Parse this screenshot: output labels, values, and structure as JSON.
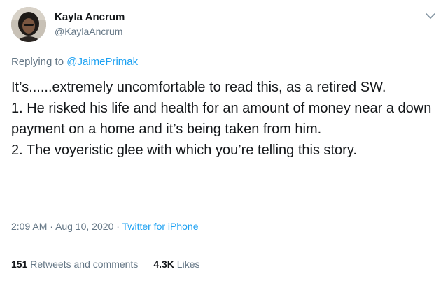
{
  "author": {
    "name": "Kayla Ancrum",
    "handle": "@KaylaAncrum"
  },
  "reply": {
    "prefix": "Replying to",
    "to": "@JaimePrimak"
  },
  "tweet_lines": [
    "It’s......extremely uncomfortable to read this, as a retired SW.",
    "1. He risked his life and health for an amount of money near a down payment on a home and it’s being taken from him.",
    "2. The voyeristic glee with which you’re telling this story."
  ],
  "meta": {
    "time": "2:09 AM",
    "date": "Aug 10, 2020",
    "separator": "·",
    "source": "Twitter for iPhone"
  },
  "stats": {
    "retweets_count": "151",
    "retweets_label": "Retweets and comments",
    "likes_count": "4.3K",
    "likes_label": "Likes"
  },
  "colors": {
    "link": "#1da1f2",
    "muted": "#657786",
    "text": "#14171a"
  }
}
